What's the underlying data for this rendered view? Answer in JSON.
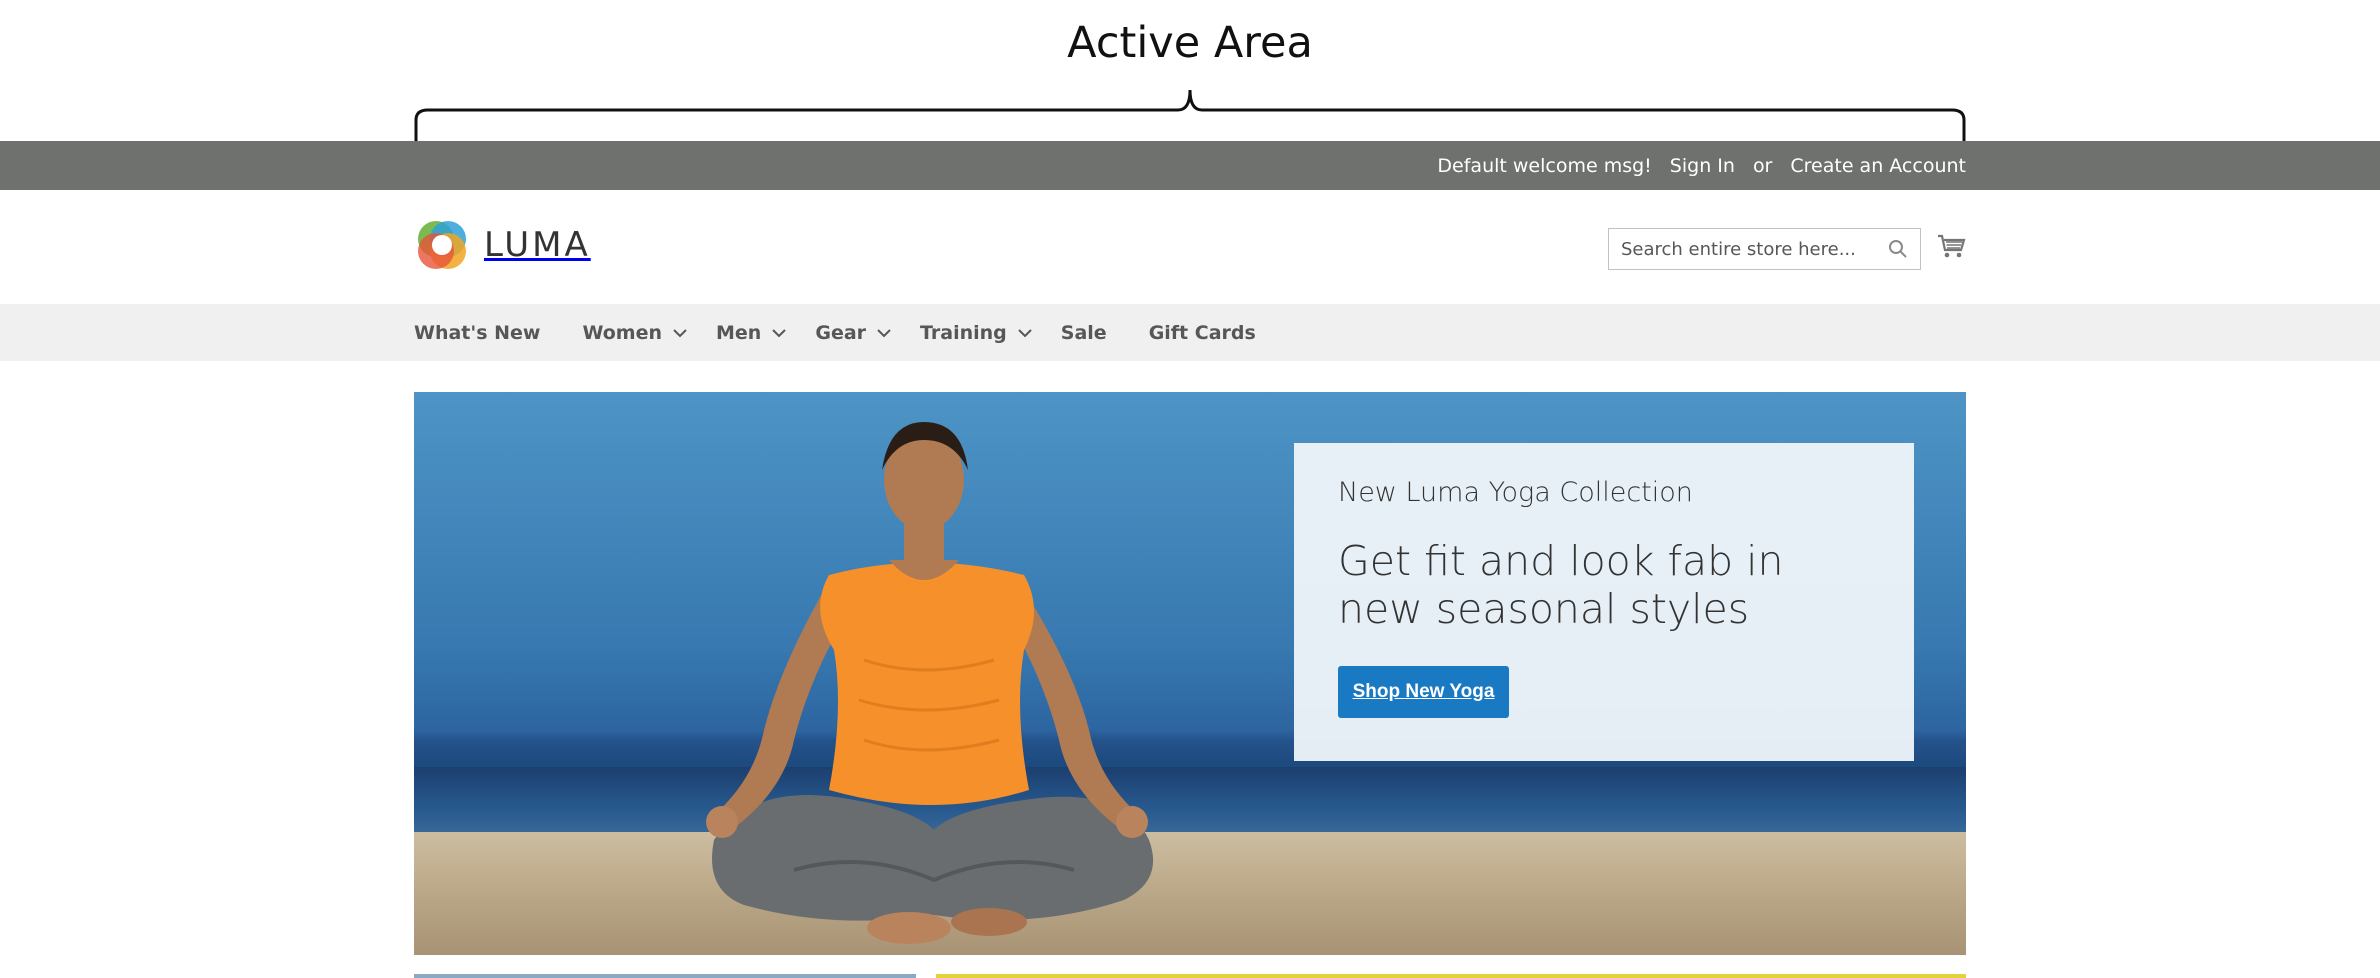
{
  "annotation": {
    "title": "Active Area"
  },
  "topbar": {
    "welcome": "Default welcome msg!",
    "sign_in": "Sign In",
    "or": "or",
    "create_account": "Create an Account"
  },
  "header": {
    "logo_text": "LUMA",
    "search": {
      "placeholder": "Search entire store here...",
      "value": ""
    },
    "icons": [
      "search-icon",
      "cart-icon"
    ]
  },
  "nav": {
    "items": [
      {
        "label": "What's New",
        "has_submenu": false
      },
      {
        "label": "Women",
        "has_submenu": true
      },
      {
        "label": "Men",
        "has_submenu": true
      },
      {
        "label": "Gear",
        "has_submenu": true
      },
      {
        "label": "Training",
        "has_submenu": true
      },
      {
        "label": "Sale",
        "has_submenu": false
      },
      {
        "label": "Gift Cards",
        "has_submenu": false
      }
    ]
  },
  "hero": {
    "subtitle": "New Luma Yoga Collection",
    "title": "Get fit and look fab in new seasonal styles",
    "button_label": "Shop New Yoga"
  },
  "colors": {
    "topbar_bg": "#6e716e",
    "nav_bg": "#f0f0f0",
    "primary_button": "#1979c3"
  }
}
